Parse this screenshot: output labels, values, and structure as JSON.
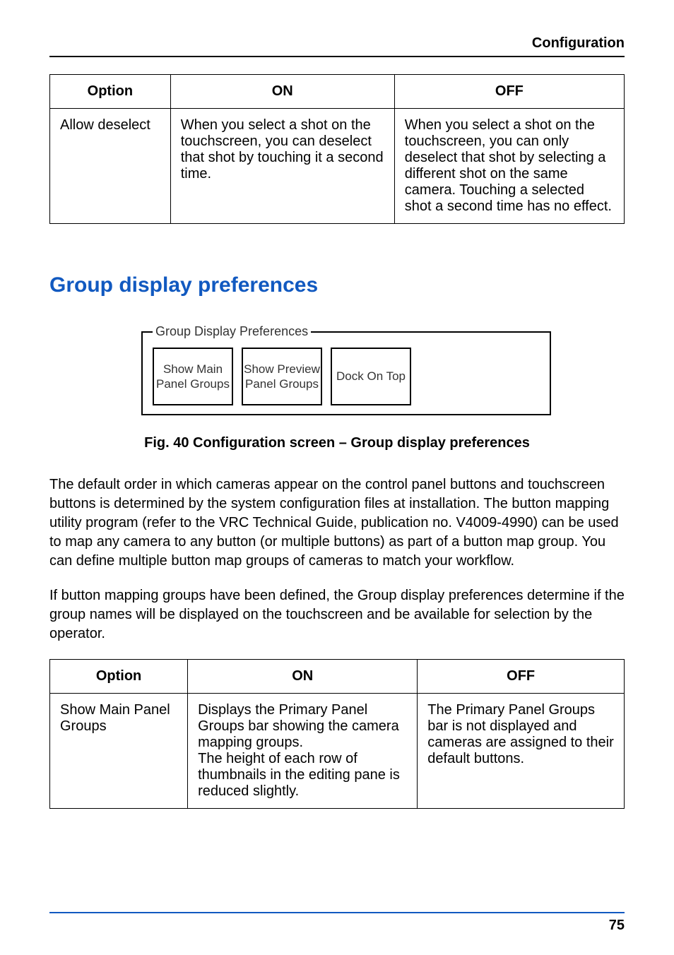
{
  "header": {
    "title": "Configuration"
  },
  "table1": {
    "headers": {
      "option": "Option",
      "on": "ON",
      "off": "OFF"
    },
    "rows": [
      {
        "option": "Allow deselect",
        "on": "When you select a shot on the touchscreen, you can deselect that shot by touching it a second time.",
        "off": "When you select a shot on the touchscreen, you can only deselect that shot by selecting a different shot on the same camera. Touching a selected shot a second time has no effect."
      }
    ]
  },
  "section_heading": "Group display preferences",
  "fieldset": {
    "legend": "Group Display Preferences",
    "buttons": [
      "Show Main Panel Groups",
      "Show Preview Panel Groups",
      "Dock On Top"
    ]
  },
  "figure_caption": "Fig. 40  Configuration screen – Group display preferences",
  "paragraphs": [
    "The default order in which cameras appear on the control panel buttons and touchscreen buttons is determined by the system configuration files at installation. The button mapping utility program (refer to the VRC Technical Guide, publication no. V4009-4990) can be used to map any camera to any button (or multiple buttons) as part of a button map group. You can define multiple button map groups of cameras to match your workflow.",
    "If button mapping groups have been defined, the Group display preferences determine if the group names will be displayed on the touchscreen and be available for selection by the operator."
  ],
  "table2": {
    "headers": {
      "option": "Option",
      "on": "ON",
      "off": "OFF"
    },
    "rows": [
      {
        "option": "Show Main Panel Groups",
        "on": "Displays the Primary Panel Groups bar showing the camera mapping groups.\nThe height of each row of thumbnails in the editing pane is reduced slightly.",
        "off": "The Primary Panel Groups bar is not displayed and cameras are assigned to their default buttons."
      }
    ]
  },
  "footer": {
    "page_number": "75"
  }
}
